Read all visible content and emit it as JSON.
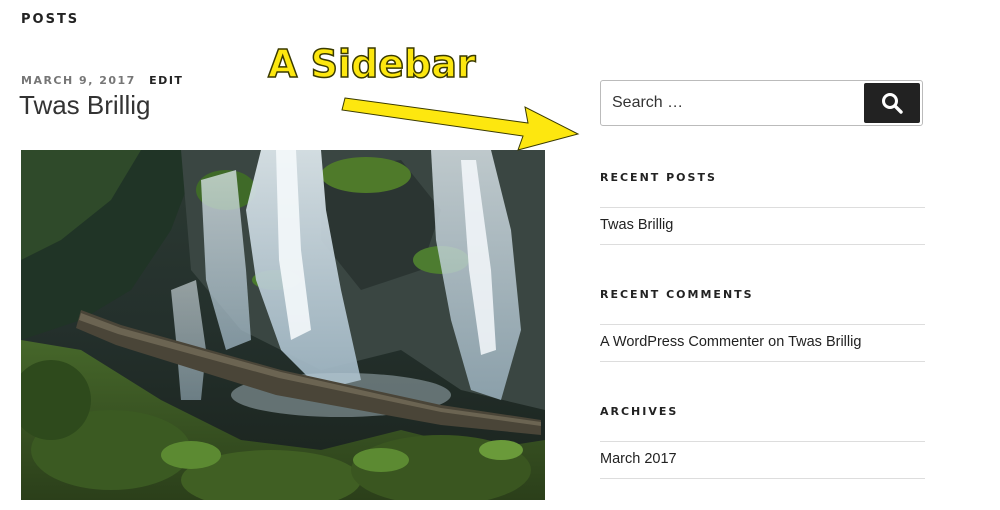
{
  "section": {
    "title": "POSTS"
  },
  "post": {
    "date": "MARCH 9, 2017",
    "edit_label": "EDIT",
    "title": "Twas Brillig"
  },
  "annotation": {
    "label": "A Sidebar",
    "color": "#fde70f"
  },
  "sidebar": {
    "search": {
      "placeholder": "Search …",
      "button_icon": "search-icon"
    },
    "recent_posts": {
      "title": "RECENT POSTS",
      "items": [
        "Twas Brillig"
      ]
    },
    "recent_comments": {
      "title": "RECENT COMMENTS",
      "items": [
        {
          "author": "A WordPress Commenter",
          "connector": "on",
          "post": "Twas Brillig"
        }
      ]
    },
    "archives": {
      "title": "ARCHIVES",
      "items": [
        "March 2017"
      ]
    }
  }
}
